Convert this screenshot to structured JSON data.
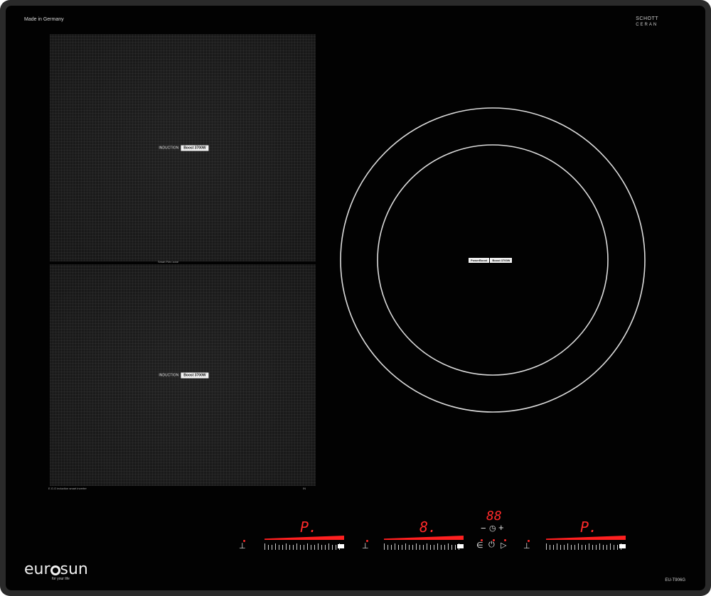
{
  "brand": {
    "made_in": "Made in Germany",
    "glass_brand_line1": "SCHOTT",
    "glass_brand_line2": "CERAN",
    "logo_text_left": "eur",
    "logo_text_right": "sun",
    "tagline": "for your life",
    "model": "EU-T906G"
  },
  "zones": {
    "top_left": {
      "label_a": "INDUCTION",
      "label_b": "Boost 3700W"
    },
    "bottom_left": {
      "label_a": "INDUCTION",
      "label_b": "Boost 3700W"
    },
    "flex_label": "Smart Flex zone",
    "bottom_note": "E.G.O induction smart inverter",
    "bottom_note2": "IN",
    "round": {
      "label_a": "PowerBoost",
      "label_b": "Boost 3700W"
    }
  },
  "displays": {
    "left": "P.",
    "middle": "8.",
    "timer": "88",
    "right": "P."
  },
  "colors": {
    "display_red": "#ff2a2a",
    "glass": "#020202",
    "frame": "#2a2a2a"
  },
  "icons": [
    "pan-icon",
    "lock-icon",
    "power-icon",
    "timer-icon",
    "pause-icon"
  ]
}
